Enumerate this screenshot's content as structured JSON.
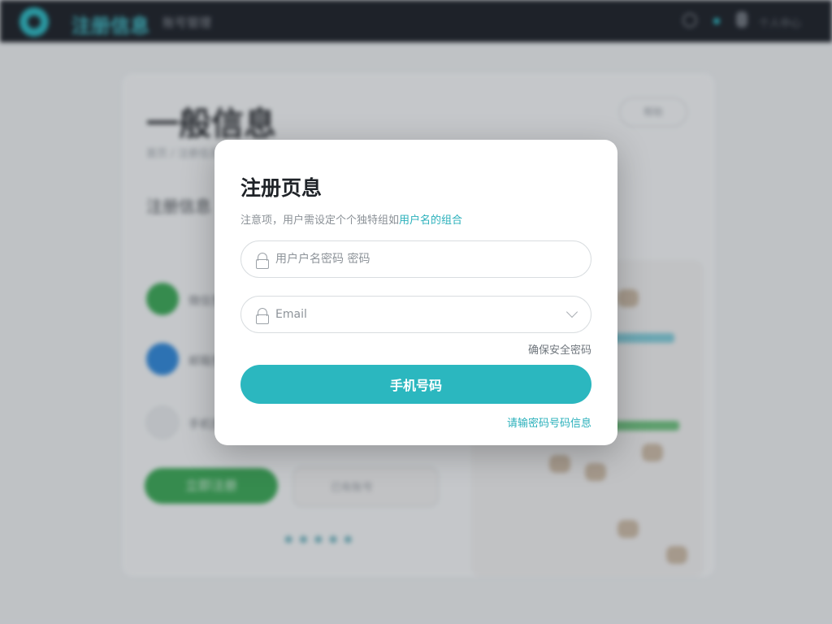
{
  "background": {
    "brand": "注册信息",
    "brand_sub": "账号管理",
    "user_label": "个人中心",
    "page_title": "一般信息",
    "breadcrumb": "首页 / 注册信息",
    "section_title": "注册信息",
    "pill_label": "帮助",
    "options": [
      {
        "label": "微信登录",
        "color": "#3aa655"
      },
      {
        "label": "邮箱登录",
        "color": "#2f86d6"
      },
      {
        "label": "手机登录",
        "color": "#d9dde0"
      }
    ],
    "primary_button": "立即注册",
    "secondary_button": "已有账号",
    "dots_text": "● ● ● ● ●"
  },
  "modal": {
    "title": "注册页息",
    "hint_prefix": "注意项，用户需设定个个独特组如",
    "hint_highlight": "用户名的组合",
    "username_placeholder": "用户户名密码 密码",
    "email_placeholder": "Email",
    "secure_link": "确保安全密码",
    "submit_label": "手机号码",
    "bottom_link": "请输密码号码信息"
  },
  "colors": {
    "accent": "#2bb7bf",
    "link_gray": "#6f767d",
    "topbar": "#1b1f26"
  }
}
